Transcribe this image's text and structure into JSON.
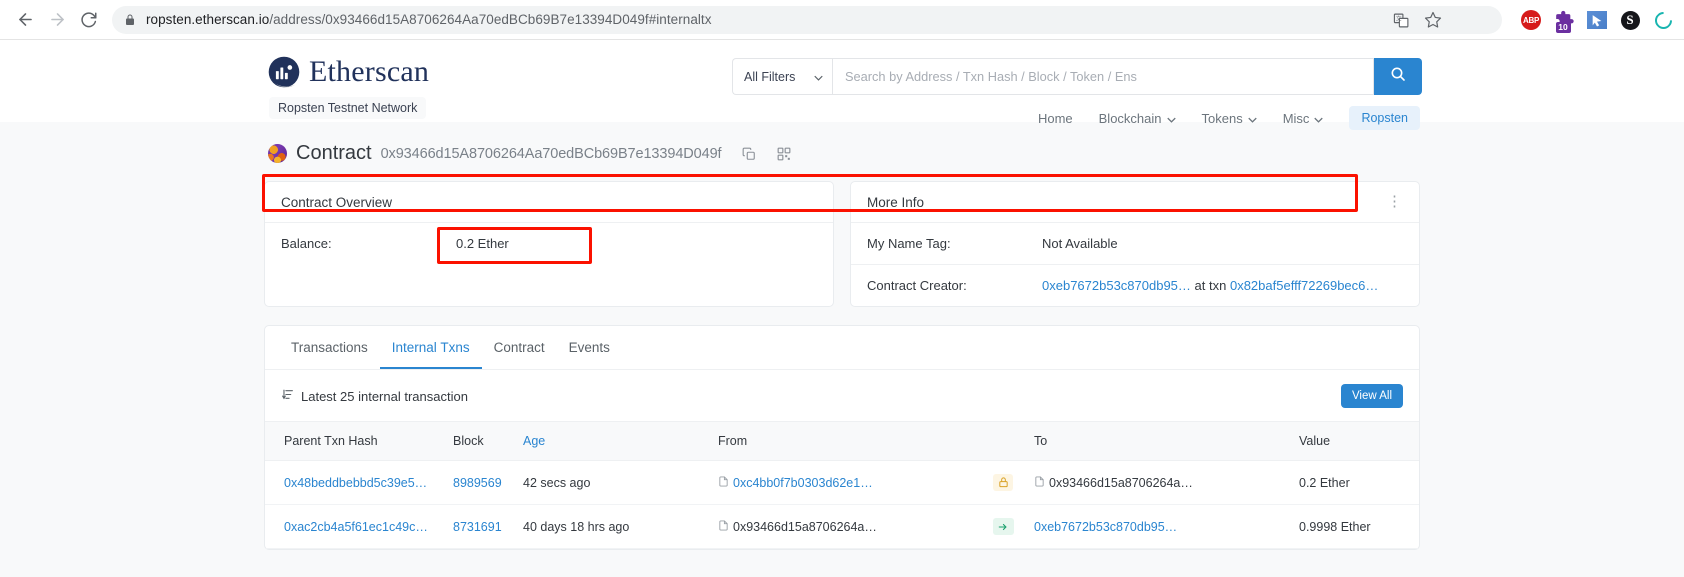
{
  "browser": {
    "url_prefix": "ropsten.etherscan.io",
    "url_path": "/address/0x93466d15A8706264Aa70edBCb69B7e13394D049f#internaltx",
    "back_icon": "back-arrow-icon",
    "forward_icon": "forward-arrow-icon",
    "reload_icon": "reload-icon",
    "lock_icon": "lock-icon",
    "translate_icon": "translate-icon",
    "bookmark_icon": "star-icon",
    "extensions": [
      {
        "name": "adblock-plus",
        "label": "ABP"
      },
      {
        "name": "extension-puzzle",
        "label": "10"
      },
      {
        "name": "blue-arrow-extension",
        "label": ""
      },
      {
        "name": "s-circle-extension",
        "label": "S"
      },
      {
        "name": "teal-arc-extension",
        "label": ""
      }
    ]
  },
  "site": {
    "brand": "Etherscan",
    "network_pill": "Ropsten Testnet Network",
    "search": {
      "filter_label": "All Filters",
      "placeholder": "Search by Address / Txn Hash / Block / Token / Ens",
      "value": "",
      "button_icon": "search-icon"
    },
    "nav": [
      {
        "label": "Home",
        "caret": false
      },
      {
        "label": "Blockchain",
        "caret": true
      },
      {
        "label": "Tokens",
        "caret": true
      },
      {
        "label": "Misc",
        "caret": true
      }
    ],
    "network_badge": "Ropsten"
  },
  "contract": {
    "label": "Contract",
    "address": "0x93466d15A8706264Aa70edBCb69B7e13394D049f",
    "copy_icon": "copy-icon",
    "qr_icon": "qr-code-icon"
  },
  "overview": {
    "title": "Contract Overview",
    "balance_label": "Balance:",
    "balance_value": "0.2 Ether"
  },
  "more_info": {
    "title": "More Info",
    "menu_icon": "vertical-dots-icon",
    "name_tag_label": "My Name Tag:",
    "name_tag_value": "Not Available",
    "creator_label": "Contract Creator:",
    "creator_address": "0xeb7672b53c870db95…",
    "at_txn_label": "at txn",
    "creator_txn": "0x82baf5efff72269bec6…"
  },
  "tabs": [
    {
      "label": "Transactions",
      "active": false
    },
    {
      "label": "Internal Txns",
      "active": true
    },
    {
      "label": "Contract",
      "active": false
    },
    {
      "label": "Events",
      "active": false
    }
  ],
  "table": {
    "caption": "Latest 25 internal transaction",
    "caption_icon": "sort-list-icon",
    "view_all": "View All",
    "columns": [
      "Parent Txn Hash",
      "Block",
      "Age",
      "From",
      "",
      "To",
      "Value"
    ],
    "rows": [
      {
        "hash": "0x48beddbebbd5c39e5…",
        "block": "8989569",
        "age": "42 secs ago",
        "from": "0xc4bb0f7b0303d62e1…",
        "from_is_link": true,
        "direction": "in",
        "direction_glyph": "⎘",
        "to": "0x93466d15a8706264a…",
        "to_is_link": false,
        "value": "0.2 Ether",
        "highlighted": true
      },
      {
        "hash": "0xac2cb4a5f61ec1c49c…",
        "block": "8731691",
        "age": "40 days 18 hrs ago",
        "from": "0x93466d15a8706264a…",
        "from_is_link": false,
        "direction": "out",
        "direction_glyph": "→",
        "to": "0xeb7672b53c870db95…",
        "to_is_link": true,
        "value": "0.9998 Ether",
        "highlighted": false
      }
    ]
  },
  "colors": {
    "accent": "#2a85d0",
    "brand_dark": "#21325b",
    "annotation": "#fb1100",
    "page_bg": "#f8f9fa"
  }
}
